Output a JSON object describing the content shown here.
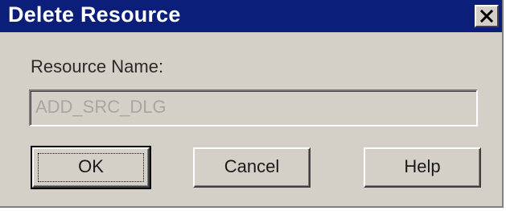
{
  "window": {
    "title": "Delete Resource",
    "close_icon": "close-x-icon"
  },
  "form": {
    "resource_name_label": "Resource Name:",
    "resource_name_value": "ADD_SRC_DLG",
    "resource_name_disabled": true
  },
  "buttons": {
    "ok_label": "OK",
    "cancel_label": "Cancel",
    "help_label": "Help"
  },
  "colors": {
    "titlebar": "#0a1e7a",
    "dialog_face": "#d4d0c8",
    "disabled_text": "#a8a6a0"
  }
}
